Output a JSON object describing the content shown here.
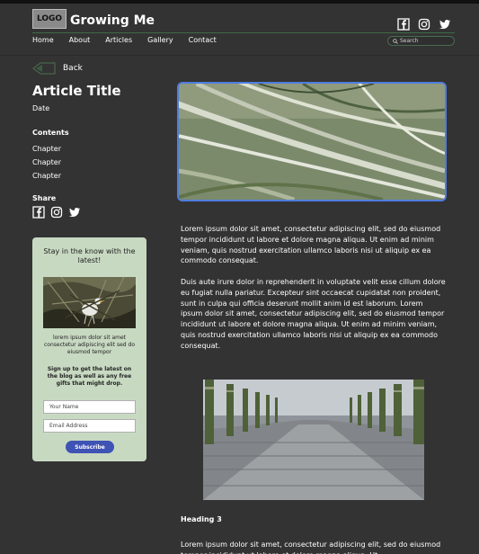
{
  "header": {
    "logo_text": "LOGO",
    "site_title": "Growing Me",
    "nav": [
      "Home",
      "About",
      "Articles",
      "Gallery",
      "Contact"
    ],
    "search_placeholder": "Search",
    "social_icons": [
      "facebook-icon",
      "instagram-icon",
      "twitter-icon"
    ]
  },
  "back": {
    "label": "Back"
  },
  "article": {
    "title": "Article Title",
    "date": "Date",
    "contents_heading": "Contents",
    "chapters": [
      "Chapter",
      "Chapter",
      "Chapter"
    ],
    "share_heading": "Share",
    "paragraph1": "Lorem ipsum dolor sit amet, consectetur adipiscing elit, sed do eiusmod tempor incididunt ut labore et dolore magna aliqua. Ut enim ad minim veniam, quis nostrud exercitation ullamco laboris nisi ut aliquip ex ea commodo consequat.",
    "paragraph2": "Duis aute irure dolor in reprehenderit in voluptate velit esse cillum dolore eu fugiat nulla pariatur. Excepteur sint occaecat cupidatat non proident, sunt in culpa qui officia deserunt mollit anim id est laborum. Lorem ipsum dolor sit amet, consectetur adipiscing elit, sed do eiusmod tempor incididunt ut labore et dolore magna aliqua. Ut enim ad minim veniam, quis nostrud exercitation ullamco laboris nisi ut aliquip ex ea commodo consequat.",
    "heading3": "Heading 3",
    "paragraph3": "Lorem ipsum dolor sit amet, consectetur adipiscing elit, sed do eiusmod tempor incididunt ut labore et dolore magna aliqua. Ut"
  },
  "newsletter": {
    "headline": "Stay in the know with the latest!",
    "blurb": "lorem ipsum dolor sit amet consectetur adipiscing elit sed do eiusmod tempor",
    "signup_text": "Sign up to get the latest on the blog as well as any free gifts that might drop.",
    "name_placeholder": "Your Name",
    "email_placeholder": "Email Address",
    "subscribe_label": "Subscribe"
  },
  "colors": {
    "background": "#333333",
    "accent_border": "#4f7cde",
    "card_background": "#c8d9c2",
    "subscribe_button": "#3f53b5"
  }
}
